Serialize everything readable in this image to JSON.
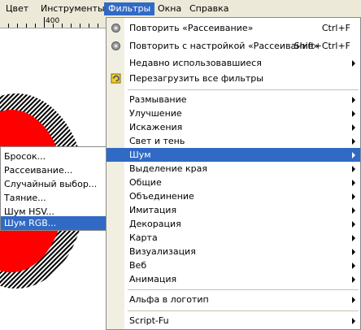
{
  "menubar": {
    "items": [
      {
        "label": "Цвет"
      },
      {
        "label": "Инструменты"
      },
      {
        "label": "Фильтры"
      },
      {
        "label": "Окна"
      },
      {
        "label": "Справка"
      }
    ]
  },
  "ruler": {
    "label": "400"
  },
  "filters_menu": {
    "repeat": {
      "label": "Повторить «Рассеивание»",
      "shortcut": "Ctrl+F",
      "icon": "repeat-filter-icon"
    },
    "reshow": {
      "label": "Повторить с настройкой «Рассеивание»",
      "shortcut": "Shift+Ctrl+F",
      "icon": "reshow-filter-icon"
    },
    "recent": {
      "label": "Недавно использовавшиеся"
    },
    "reset": {
      "label": "Перезагрузить все фильтры",
      "icon": "reload-icon"
    },
    "items": [
      {
        "label": "Размывание"
      },
      {
        "label": "Улучшение"
      },
      {
        "label": "Искажения"
      },
      {
        "label": "Свет и тень"
      },
      {
        "label": "Шум"
      },
      {
        "label": "Выделение края"
      },
      {
        "label": "Общие"
      },
      {
        "label": "Объединение"
      },
      {
        "label": "Имитация"
      },
      {
        "label": "Декорация"
      },
      {
        "label": "Карта"
      },
      {
        "label": "Визуализация"
      },
      {
        "label": "Веб"
      },
      {
        "label": "Анимация"
      }
    ],
    "alpha_to_logo": {
      "label": "Альфа в логотип"
    },
    "script_fu": {
      "label": "Script-Fu"
    }
  },
  "noise_submenu": {
    "items": [
      {
        "label": "Бросок..."
      },
      {
        "label": "Рассеивание..."
      },
      {
        "label": "Случайный выбор..."
      },
      {
        "label": "Таяние..."
      },
      {
        "label": "Шум HSV..."
      },
      {
        "label": "Шум RGB..."
      }
    ]
  },
  "colors": {
    "highlight": "#316ac5",
    "menubar": "#ece9d8",
    "gutter": "#f1efe2",
    "blob": "#ff0000"
  }
}
